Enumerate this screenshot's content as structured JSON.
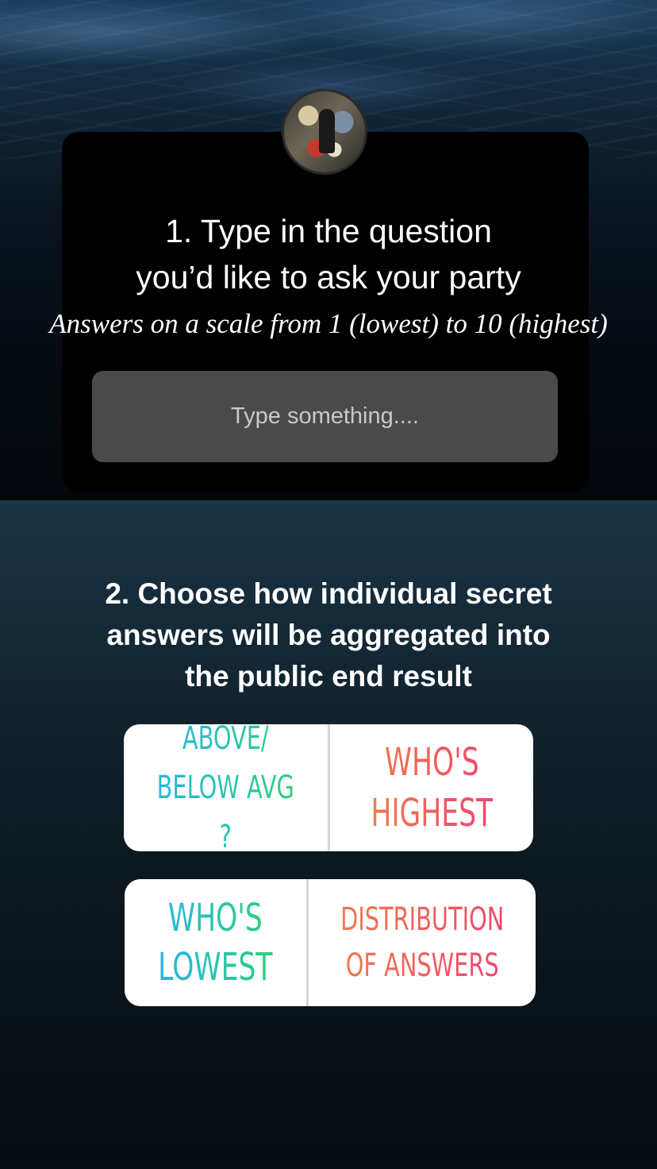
{
  "step1": {
    "title_line1": "1. Type in the question",
    "title_line2": "you’d like to ask your party",
    "subtitle": "Answers on a scale from 1 (lowest) to 10 (highest)",
    "input_placeholder": "Type something...."
  },
  "step2": {
    "title_line1": "2. Choose how individual secret",
    "title_line2": "answers will be aggregated into",
    "title_line3": "the public end result"
  },
  "options": {
    "above_below_line1": "ABOVE/",
    "above_below_line2": "BELOW AVG ?",
    "highest_line1": "WHO'S",
    "highest_line2": "HIGHEST",
    "lowest_line1": "WHO'S",
    "lowest_line2": "LOWEST",
    "distribution_line1": "DISTRIBUTION",
    "distribution_line2": "OF ANSWERS"
  },
  "colors": {
    "teal_gradient_start": "#27b6e4",
    "teal_gradient_end": "#2fd07a",
    "warm_gradient_start": "#f07a4a",
    "warm_gradient_end": "#f0466e",
    "card_background": "#000000",
    "input_background": "#4a4a4a"
  },
  "icons": {
    "avatar": "profile-avatar"
  }
}
